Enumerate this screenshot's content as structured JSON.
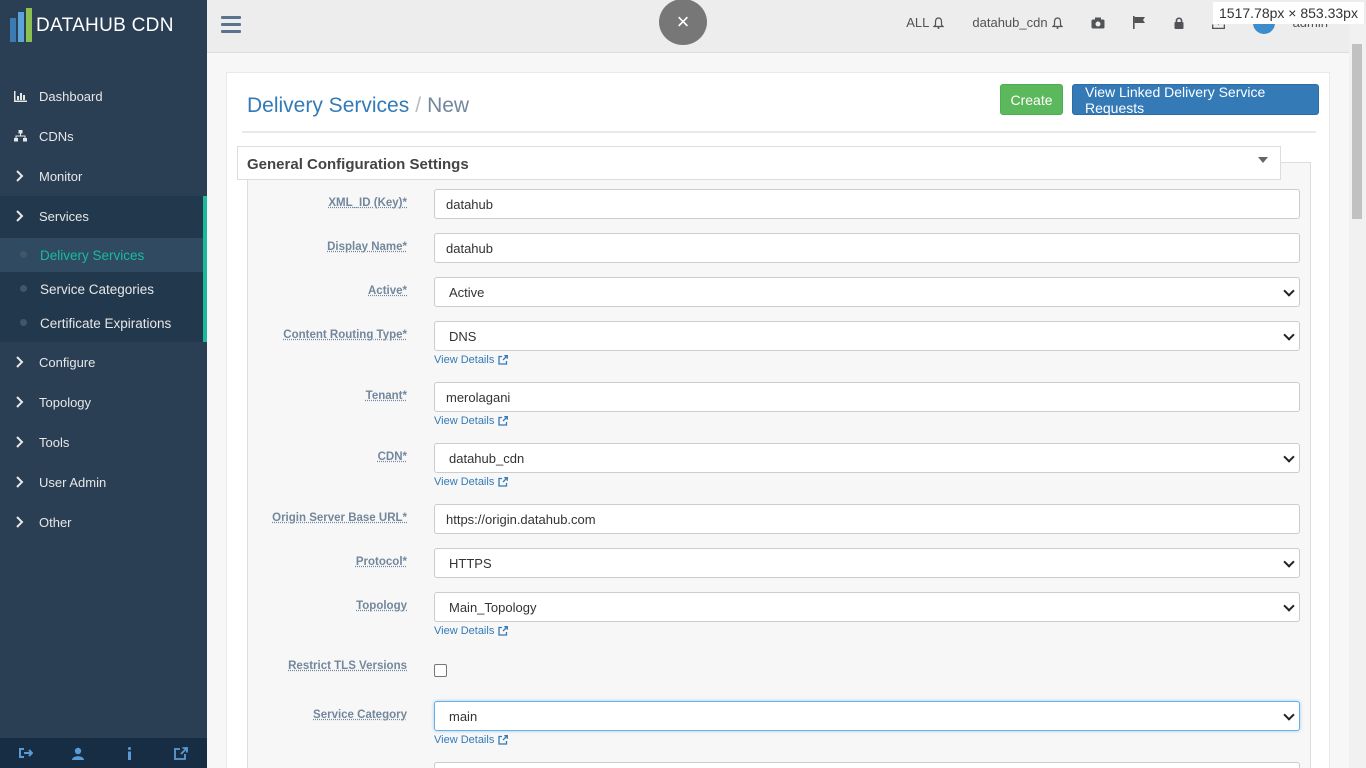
{
  "brand": {
    "name": "DATAHUB CDN"
  },
  "sidebar": {
    "items": [
      {
        "label": "Dashboard",
        "icon": "bar-chart-icon"
      },
      {
        "label": "CDNs",
        "icon": "sitemap-icon"
      },
      {
        "label": "Monitor",
        "icon": "chevron-right-icon"
      },
      {
        "label": "Services",
        "icon": "chevron-right-icon"
      },
      {
        "label": "Configure",
        "icon": "chevron-right-icon"
      },
      {
        "label": "Topology",
        "icon": "chevron-right-icon"
      },
      {
        "label": "Tools",
        "icon": "chevron-right-icon"
      },
      {
        "label": "User Admin",
        "icon": "chevron-right-icon"
      },
      {
        "label": "Other",
        "icon": "chevron-right-icon"
      }
    ],
    "services_sub": [
      {
        "label": "Delivery Services"
      },
      {
        "label": "Service Categories"
      },
      {
        "label": "Certificate Expirations"
      }
    ],
    "footer_icons": [
      "sign-out-icon",
      "user-icon",
      "info-icon",
      "external-link-icon"
    ]
  },
  "topnav": {
    "all_label": "ALL",
    "cdn_label": "datahub_cdn",
    "user_label": "admin"
  },
  "overlay": {
    "close_symbol": "×",
    "size_tip": "1517.78px × 853.33px"
  },
  "page": {
    "breadcrumb_root": "Delivery Services",
    "breadcrumb_sep": "/",
    "breadcrumb_current": "New",
    "create_label": "Create",
    "linked_label": "View Linked Delivery Service Requests"
  },
  "section": {
    "title": "General Configuration Settings"
  },
  "form": {
    "view_details": "View Details",
    "xml_id": {
      "label": "XML_ID (Key)*",
      "value": "datahub"
    },
    "display_name": {
      "label": "Display Name*",
      "value": "datahub"
    },
    "active": {
      "label": "Active*",
      "value": "Active"
    },
    "routing_type": {
      "label": "Content Routing Type*",
      "value": "DNS"
    },
    "tenant": {
      "label": "Tenant*",
      "value": "merolagani"
    },
    "cdn": {
      "label": "CDN*",
      "value": "datahub_cdn"
    },
    "origin_url": {
      "label": "Origin Server Base URL*",
      "value": "https://origin.datahub.com"
    },
    "protocol": {
      "label": "Protocol*",
      "value": "HTTPS"
    },
    "topology": {
      "label": "Topology",
      "value": "Main_Topology"
    },
    "restrict_tls": {
      "label": "Restrict TLS Versions",
      "checked": false
    },
    "service_category": {
      "label": "Service Category",
      "value": "main"
    }
  }
}
